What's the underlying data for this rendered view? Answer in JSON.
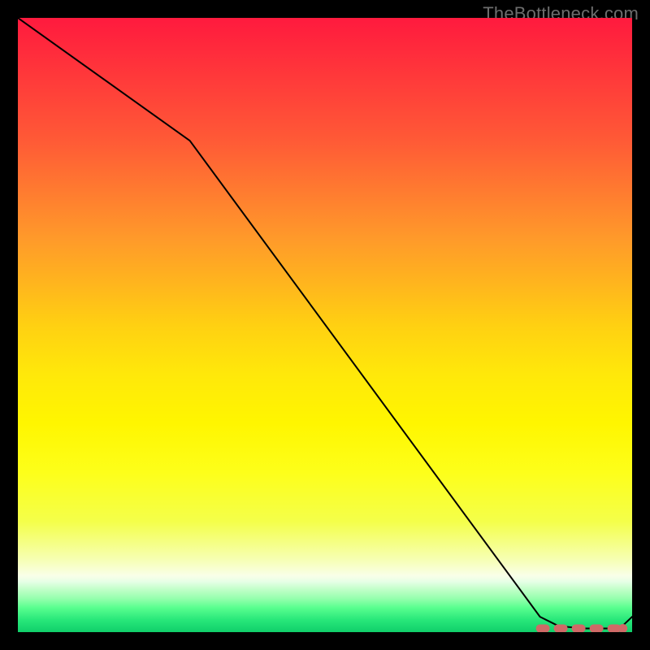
{
  "watermark": "TheBottleneck.com",
  "chart_data": {
    "type": "line",
    "title": "",
    "xlabel": "",
    "ylabel": "",
    "xlim": [
      0,
      100
    ],
    "ylim": [
      0,
      100
    ],
    "series": [
      {
        "name": "curve",
        "x": [
          0,
          28,
          85,
          88,
          92,
          96,
          98,
          100
        ],
        "values": [
          100,
          80,
          2.5,
          1.0,
          0.6,
          0.6,
          0.6,
          2.5
        ]
      }
    ],
    "annotations": [
      {
        "name": "flat-dash",
        "kind": "dashed_segment",
        "x0": 85,
        "x1": 98,
        "y": 0.6
      },
      {
        "name": "dash-end-dot",
        "kind": "dot",
        "x": 98.5,
        "y": 0.6
      }
    ],
    "gradient_stops": [
      {
        "offset": 0.0,
        "color": "#ff1a3e"
      },
      {
        "offset": 0.1,
        "color": "#ff3a3a"
      },
      {
        "offset": 0.2,
        "color": "#ff5a36"
      },
      {
        "offset": 0.28,
        "color": "#ff7a30"
      },
      {
        "offset": 0.36,
        "color": "#ff9a2a"
      },
      {
        "offset": 0.43,
        "color": "#ffb41e"
      },
      {
        "offset": 0.5,
        "color": "#ffd012"
      },
      {
        "offset": 0.58,
        "color": "#ffe80a"
      },
      {
        "offset": 0.66,
        "color": "#fff600"
      },
      {
        "offset": 0.74,
        "color": "#fdff1a"
      },
      {
        "offset": 0.82,
        "color": "#f4ff4a"
      },
      {
        "offset": 0.88,
        "color": "#f6ffb0"
      },
      {
        "offset": 0.908,
        "color": "#f9ffe8"
      },
      {
        "offset": 0.918,
        "color": "#e6ffe6"
      },
      {
        "offset": 0.93,
        "color": "#c2ffc9"
      },
      {
        "offset": 0.945,
        "color": "#97ffae"
      },
      {
        "offset": 0.96,
        "color": "#5aff8f"
      },
      {
        "offset": 0.98,
        "color": "#28e77a"
      },
      {
        "offset": 1.0,
        "color": "#10cf6a"
      }
    ],
    "curve_color": "#000000",
    "dash_color": "#cf6a67"
  }
}
